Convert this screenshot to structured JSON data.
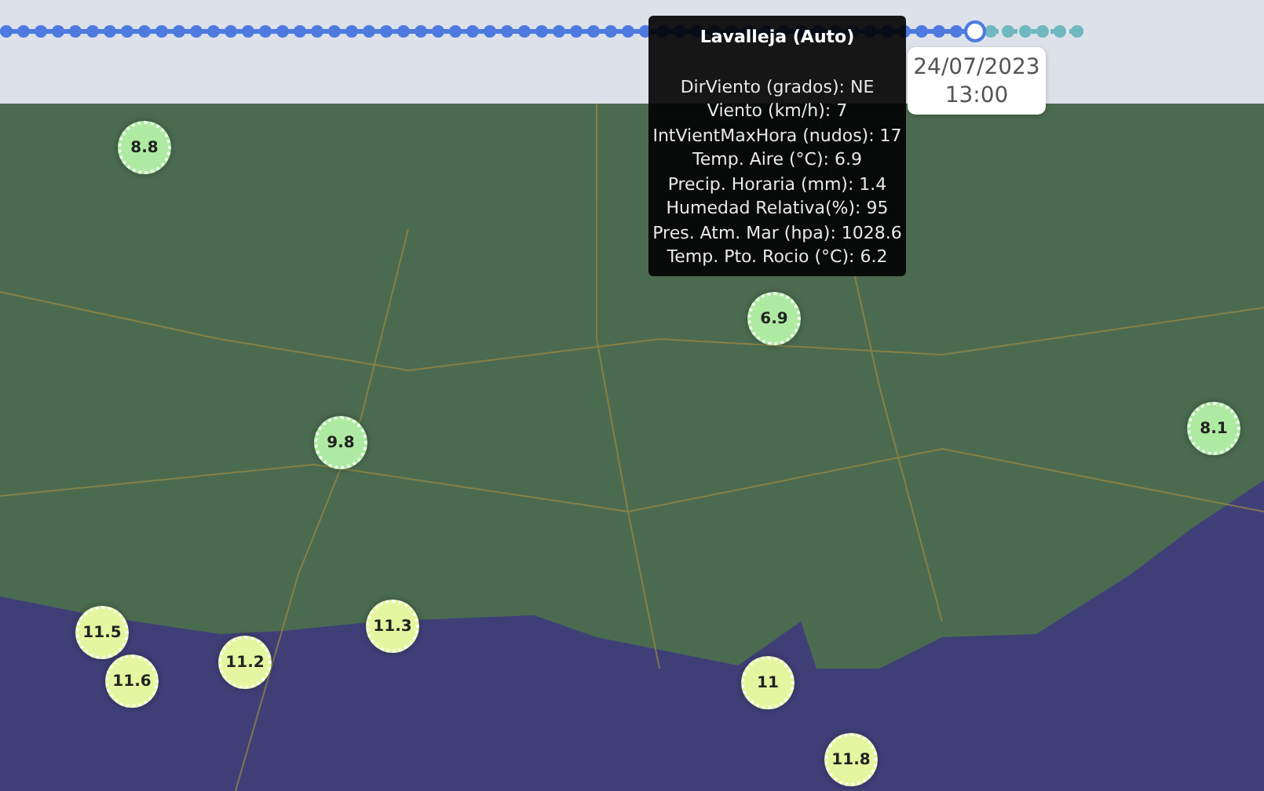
{
  "timeline": {
    "level": 0.9,
    "date": "24/07/2023",
    "time": "13:00"
  },
  "tooltip": {
    "title": "Lavalleja (Auto)",
    "lines": [
      "DirViento (grados): NE",
      "Viento (km/h): 7",
      "IntVientMaxHora (nudos): 17",
      "Temp. Aire (°C): 6.9",
      "Precip. Horaria (mm): 1.4",
      "Humedad Relativa(%): 95",
      "Pres. Atm. Mar (hpa): 1028.6",
      "Temp. Pto. Rocio (°C): 6.2"
    ]
  },
  "markers": [
    {
      "value": "8.8",
      "color": "#aeeaa2"
    },
    {
      "value": "6.9",
      "color": "#aeeaa2"
    },
    {
      "value": "9.8",
      "color": "#aeeaa2"
    },
    {
      "value": "8.1",
      "color": "#aeeaa2"
    },
    {
      "value": "11.5",
      "color": "#e4f7a0"
    },
    {
      "value": "11.6",
      "color": "#e4f7a0"
    },
    {
      "value": "11.2",
      "color": "#e4f7a0"
    },
    {
      "value": "11.3",
      "color": "#e4f7a0"
    },
    {
      "value": "11",
      "color": "#e4f7a0"
    },
    {
      "value": "11.8",
      "color": "#e4f7a0"
    }
  ]
}
